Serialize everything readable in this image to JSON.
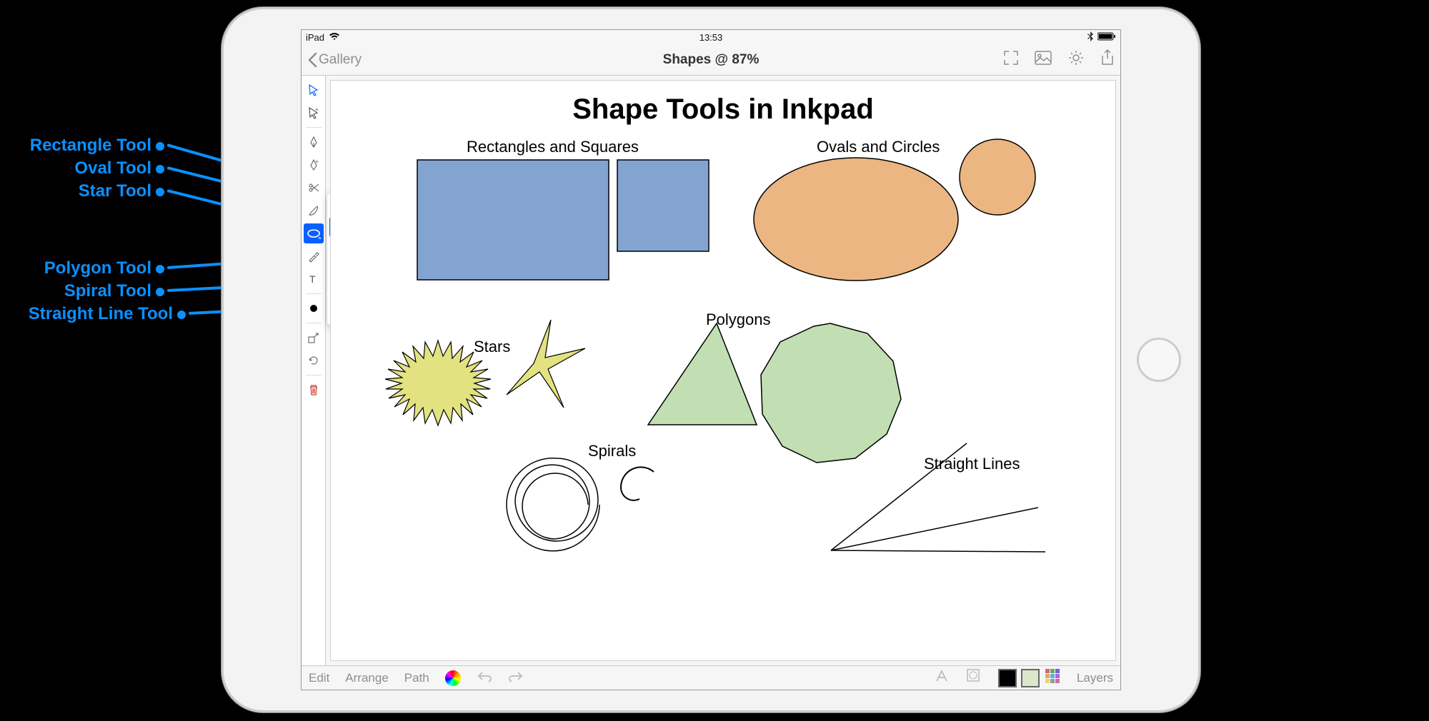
{
  "statusbar": {
    "carrier": "iPad",
    "time": "13:53"
  },
  "navbar": {
    "back": "Gallery",
    "title": "Shapes @ 87%"
  },
  "canvas": {
    "title": "Shape Tools in Inkpad",
    "labels": {
      "rects": "Rectangles and Squares",
      "ovals": "Ovals and Circles",
      "stars": "Stars",
      "polygons": "Polygons",
      "spirals": "Spirals",
      "lines": "Straight Lines"
    }
  },
  "bottombar": {
    "edit": "Edit",
    "arrange": "Arrange",
    "path": "Path",
    "layers": "Layers"
  },
  "callouts": {
    "rectangle": "Rectangle Tool",
    "oval": "Oval Tool",
    "star": "Star Tool",
    "polygon": "Polygon Tool",
    "spiral": "Spiral Tool",
    "line": "Straight Line Tool"
  },
  "colors": {
    "accent": "#0a60ff",
    "rect_fill": "#83a3d1",
    "oval_fill": "#ebb681",
    "green_fill": "#c1dfb3",
    "star_fill": "#e3e280"
  }
}
